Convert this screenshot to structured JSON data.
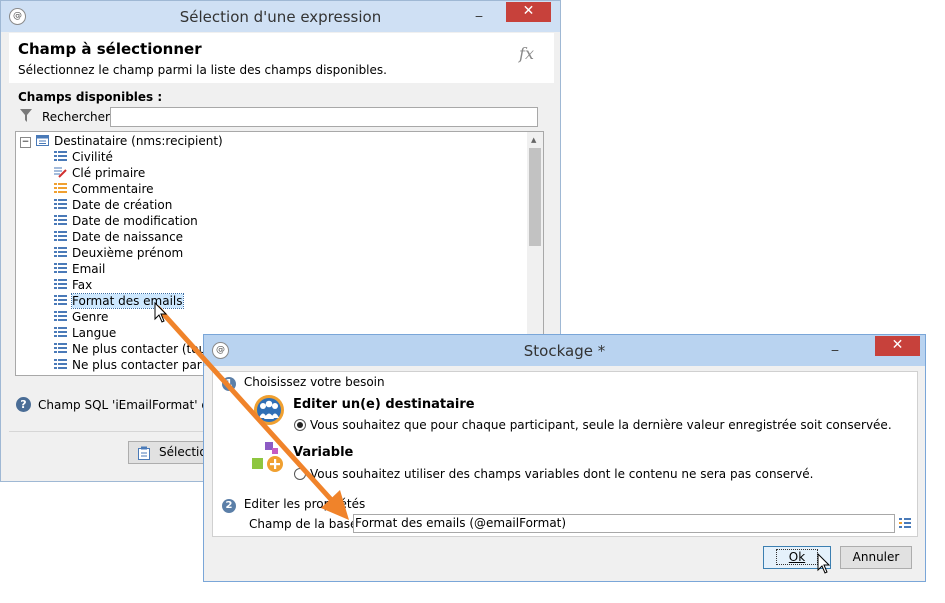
{
  "left_window": {
    "title": "Sélection d'une expression",
    "header_title": "Champ à sélectionner",
    "header_subtitle": "Sélectionnez le champ parmi la liste des champs disponibles.",
    "fx_label": "fx",
    "available_label": "Champs disponibles :",
    "search_label": "Rechercher:",
    "search_value": "",
    "tree_root": "Destinataire (nms:recipient)",
    "tree_items": [
      {
        "label": "Civilité",
        "icon": "list-field-icon"
      },
      {
        "label": "Clé primaire",
        "icon": "key-field-icon"
      },
      {
        "label": "Commentaire",
        "icon": "memo-field-icon"
      },
      {
        "label": "Date de création",
        "icon": "list-field-icon"
      },
      {
        "label": "Date de modification",
        "icon": "list-field-icon"
      },
      {
        "label": "Date de naissance",
        "icon": "list-field-icon"
      },
      {
        "label": "Deuxième prénom",
        "icon": "list-field-icon"
      },
      {
        "label": "Email",
        "icon": "list-field-icon"
      },
      {
        "label": "Fax",
        "icon": "list-field-icon"
      },
      {
        "label": "Format des emails",
        "icon": "list-field-icon",
        "selected": true
      },
      {
        "label": "Genre",
        "icon": "list-field-icon"
      },
      {
        "label": "Langue",
        "icon": "list-field-icon"
      },
      {
        "label": "Ne plus contacter (tous c",
        "icon": "list-field-icon"
      },
      {
        "label": "Ne plus contacter par c",
        "icon": "list-field-icon"
      }
    ],
    "sql_info": "Champ SQL 'iEmailFormat' de t",
    "select_button": "Sélection"
  },
  "right_window": {
    "title": "Stockage *",
    "step1_number": "1",
    "step1_label": "Choisissez votre besoin",
    "option1_title": "Editer un(e) destinataire",
    "option1_desc": "Vous souhaitez que pour chaque participant, seule la dernière valeur enregistrée soit conservée.",
    "option2_title": "Variable",
    "option2_desc": "Vous souhaitez utiliser des champs variables dont le contenu ne sera pas conservé.",
    "step2_number": "2",
    "step2_label": "Editer les propriétés",
    "field_label": "Champ de la base:",
    "field_value": "Format des emails (@emailFormat)",
    "ok_button": "Ok",
    "cancel_button": "Annuler"
  },
  "colors": {
    "selection": "#cde8ff",
    "arrow": "#f0832a",
    "close": "#c7413b"
  }
}
